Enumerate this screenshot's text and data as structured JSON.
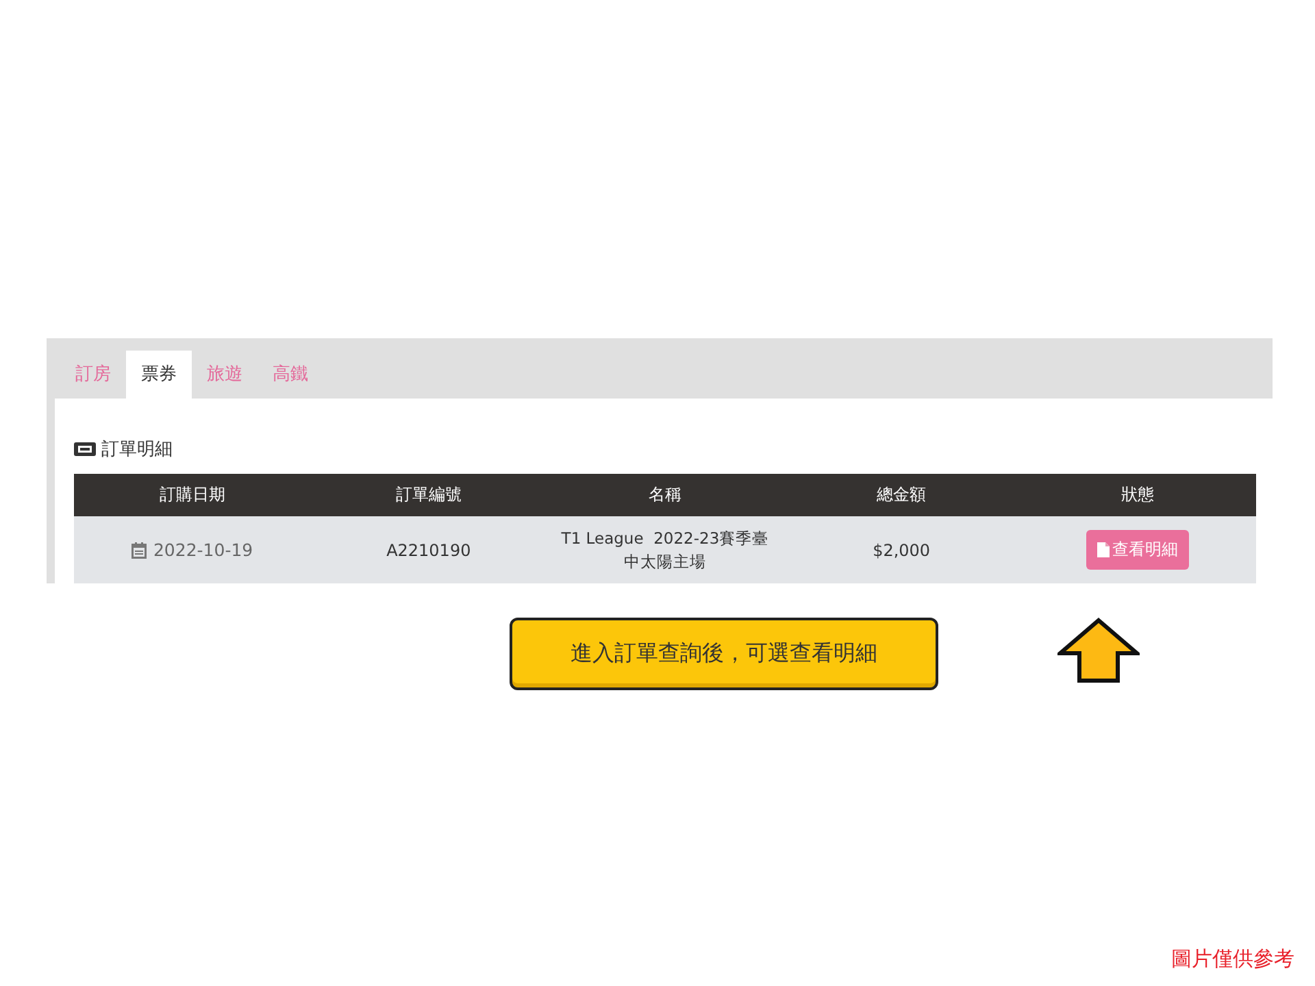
{
  "tabs": [
    {
      "label": "訂房",
      "selected": false
    },
    {
      "label": "票券",
      "selected": true
    },
    {
      "label": "旅遊",
      "selected": false
    },
    {
      "label": "高鐵",
      "selected": false
    }
  ],
  "section_title": "訂單明細",
  "table": {
    "columns": [
      "訂購日期",
      "訂單編號",
      "名稱",
      "總金額",
      "狀態"
    ],
    "rows": [
      {
        "date": "2022-10-19",
        "order_no": "A2210190",
        "name": "T1 League  2022-23賽季臺中太陽主場",
        "amount": "$2,000",
        "action": "查看明細"
      }
    ]
  },
  "callout": "進入訂單查詢後，可選查看明細",
  "note": "圖片僅供參考"
}
